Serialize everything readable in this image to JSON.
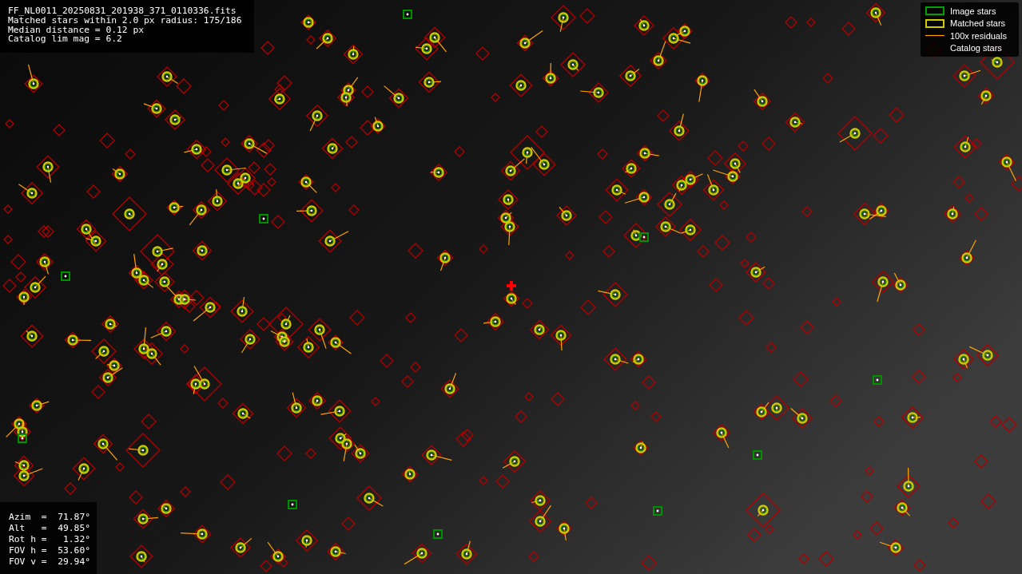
{
  "info_lines": [
    "FF_NL0011_20250831_201938_371_0110336.fits",
    "Matched stars within 2.0 px radius: 175/186",
    "Median distance = 0.12 px",
    "Catalog lim mag = 6.2"
  ],
  "legend": [
    {
      "kind": "image",
      "label": "Image stars"
    },
    {
      "kind": "matched",
      "label": "Matched stars"
    },
    {
      "kind": "residual",
      "label": "100x residuals"
    },
    {
      "kind": "catalog",
      "label": "Catalog stars"
    }
  ],
  "pointing": [
    "Azim  =  71.87°",
    "Alt   =  49.85°",
    "Rot h =   1.32°",
    "FOV h =  53.60°",
    "FOV v =  29.94°"
  ]
}
